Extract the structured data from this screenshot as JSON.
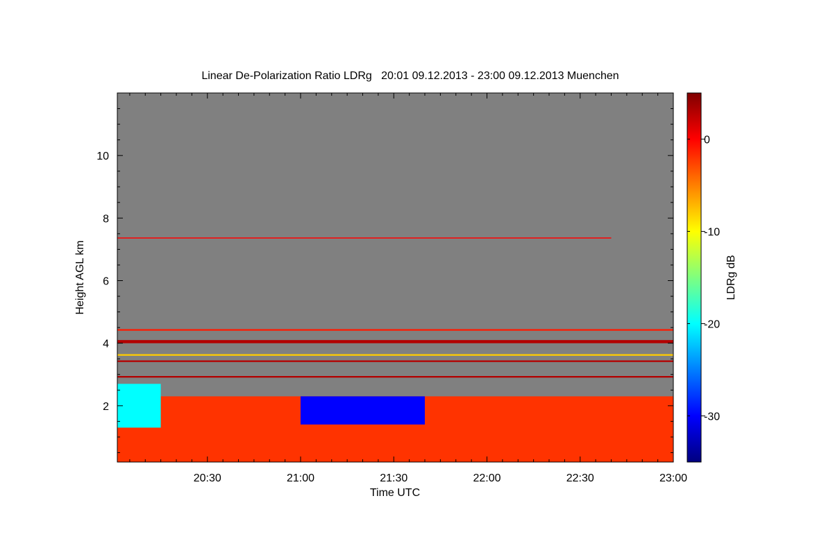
{
  "chart_data": {
    "type": "heatmap",
    "title": "Linear De-Polarization Ratio LDRg   20:01 09.12.2013 - 23:00 09.12.2013 Muenchen",
    "xlabel": "Time UTC",
    "ylabel": "Height AGL km",
    "colorbar_label": "LDRg dB",
    "x_range": [
      "20:01",
      "23:00"
    ],
    "xlim_minutes_utc": [
      1201,
      1380
    ],
    "x_tick_labels": [
      "20:30",
      "21:00",
      "21:30",
      "22:00",
      "22:30",
      "23:00"
    ],
    "x_tick_minutes_utc": [
      1230,
      1260,
      1290,
      1320,
      1350,
      1380
    ],
    "ylim": [
      0.2,
      12.0
    ],
    "y_tick_labels": [
      "2",
      "4",
      "6",
      "8",
      "10"
    ],
    "y_ticks": [
      2,
      4,
      6,
      8,
      10
    ],
    "colorbar_range": [
      -35,
      5
    ],
    "colorbar_tick_labels": [
      "0",
      "-10",
      "-20",
      "-30"
    ],
    "colorbar_ticks": [
      0,
      -10,
      -20,
      -30
    ],
    "colormap": "jet",
    "no_signal_color": "#808080",
    "layers": [
      {
        "from_km": 0.2,
        "to_km": 2.3,
        "from_time": "20:01",
        "to_time": "23:00",
        "ldr_db": -2,
        "note": "red/orange/yellow striped boundary layer"
      },
      {
        "from_km": 1.4,
        "to_km": 2.3,
        "from_time": "21:00",
        "to_time": "21:40",
        "ldr_db": -30
      },
      {
        "from_km": 1.3,
        "to_km": 2.7,
        "from_time": "20:01",
        "to_time": "20:15",
        "ldr_db": -20
      },
      {
        "from_km": 2.9,
        "to_km": 2.95,
        "from_time": "20:01",
        "to_time": "23:00",
        "ldr_db": 3
      },
      {
        "from_km": 3.4,
        "to_km": 3.45,
        "from_time": "20:01",
        "to_time": "23:00",
        "ldr_db": 3
      },
      {
        "from_km": 3.6,
        "to_km": 3.65,
        "from_time": "20:01",
        "to_time": "23:00",
        "ldr_db": -8
      },
      {
        "from_km": 4.0,
        "to_km": 4.1,
        "from_time": "20:01",
        "to_time": "23:00",
        "ldr_db": 3
      },
      {
        "from_km": 4.4,
        "to_km": 4.45,
        "from_time": "20:01",
        "to_time": "23:00",
        "ldr_db": -1
      },
      {
        "from_km": 7.35,
        "to_km": 7.38,
        "from_time": "20:01",
        "to_time": "22:40",
        "ldr_db": 0
      }
    ]
  }
}
